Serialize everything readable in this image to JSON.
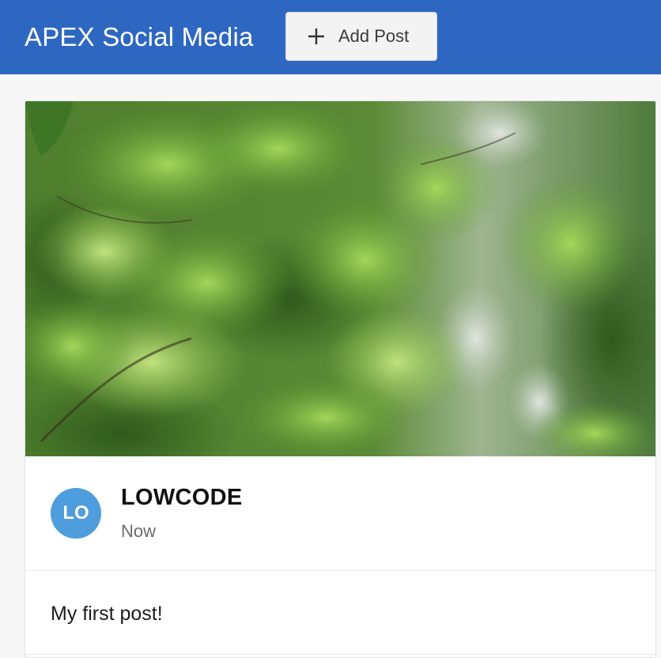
{
  "header": {
    "app_title": "APEX Social Media",
    "add_post_label": "Add Post",
    "add_post_icon": "plus-icon",
    "background_color": "#2e67c2"
  },
  "post": {
    "image_description_icon": "post-image",
    "avatar_initials": "LO",
    "avatar_color": "#4e9ddc",
    "author": "LOWCODE",
    "time": "Now",
    "text": "My first post!"
  }
}
